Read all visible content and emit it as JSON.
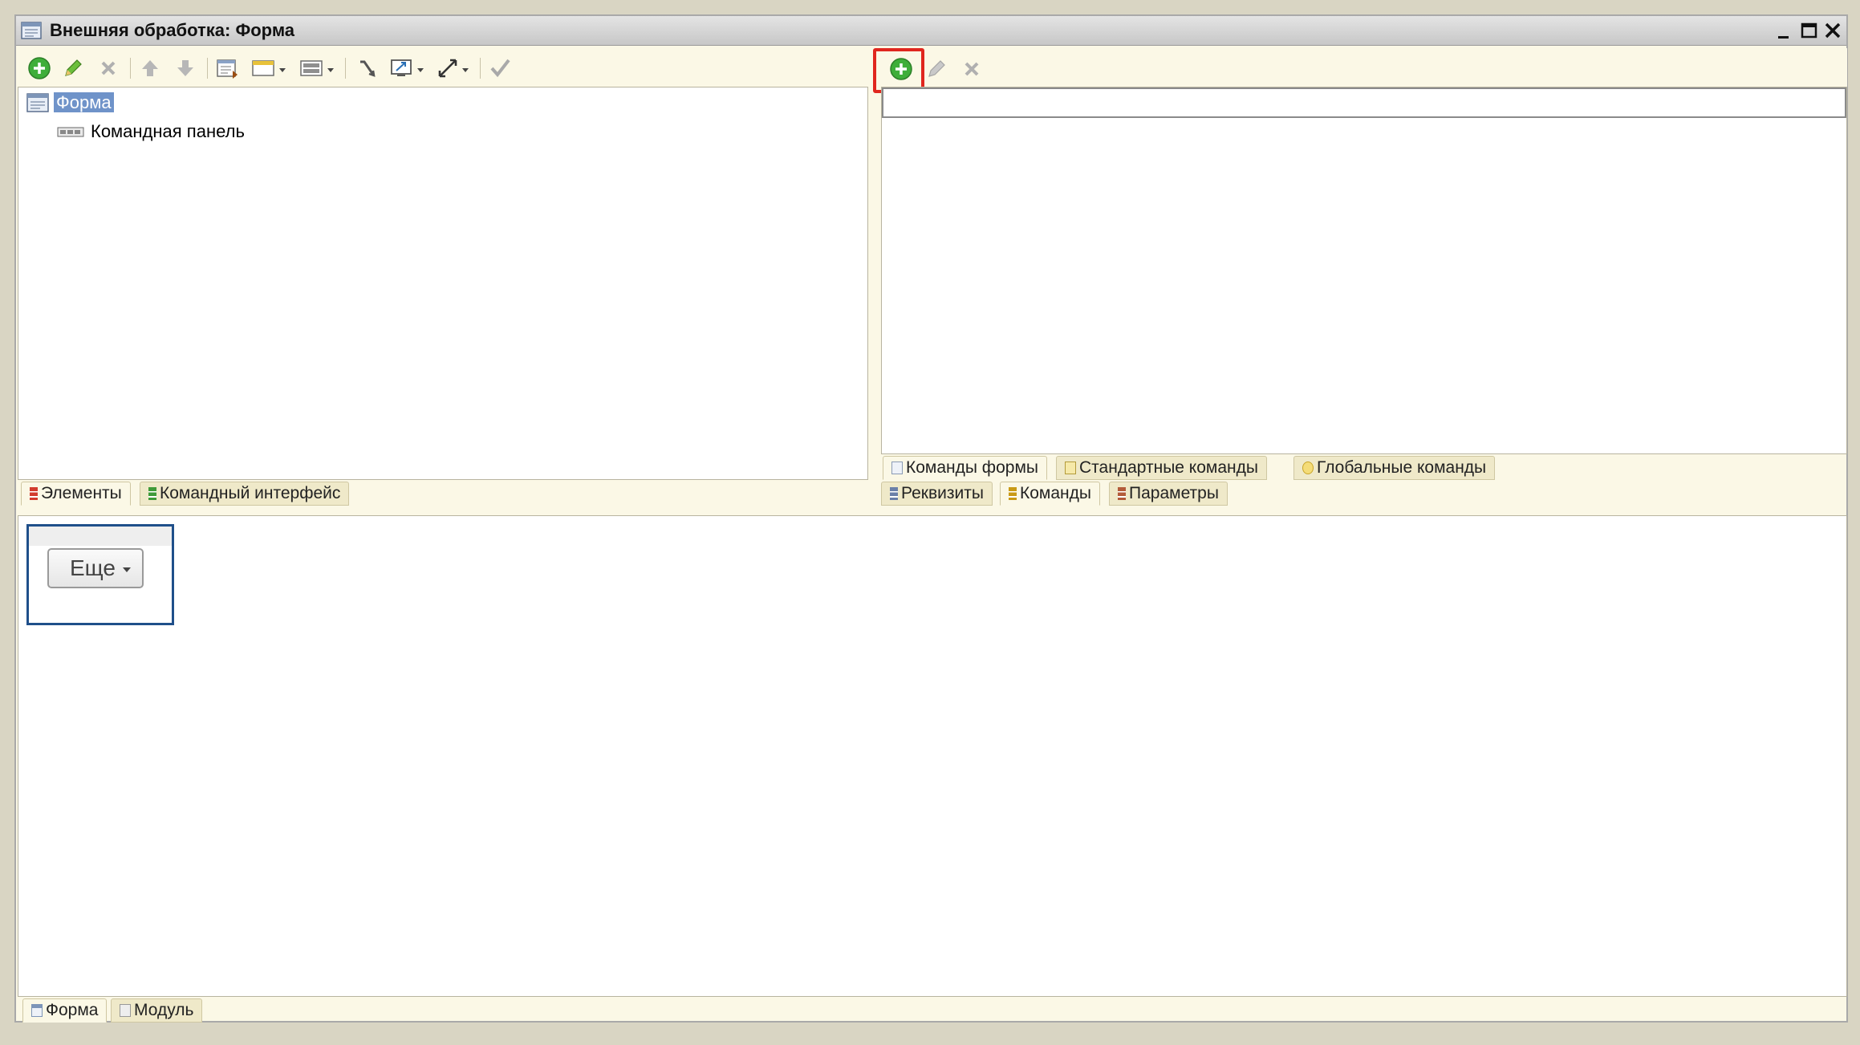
{
  "window": {
    "title": "Внешняя обработка: Форма"
  },
  "elements_tree": {
    "items": [
      {
        "label": "Форма",
        "icon": "form-icon",
        "selected": true
      },
      {
        "label": "Командная панель",
        "icon": "command-panel-icon",
        "selected": false
      }
    ],
    "tabs": [
      "Элементы",
      "Командный интерфейс"
    ]
  },
  "commands_panel": {
    "input_value": "",
    "subtabs": [
      "Команды формы",
      "Стандартные команды",
      "Глобальные команды"
    ],
    "tabs": [
      "Реквизиты",
      "Команды",
      "Параметры"
    ]
  },
  "preview": {
    "more_button_label": "Еще"
  },
  "bottom_tabs": [
    "Форма",
    "Модуль"
  ],
  "colors": {
    "selection": "#6f93c9",
    "highlight": "#e0261e",
    "add_green": "#3fae3a"
  }
}
